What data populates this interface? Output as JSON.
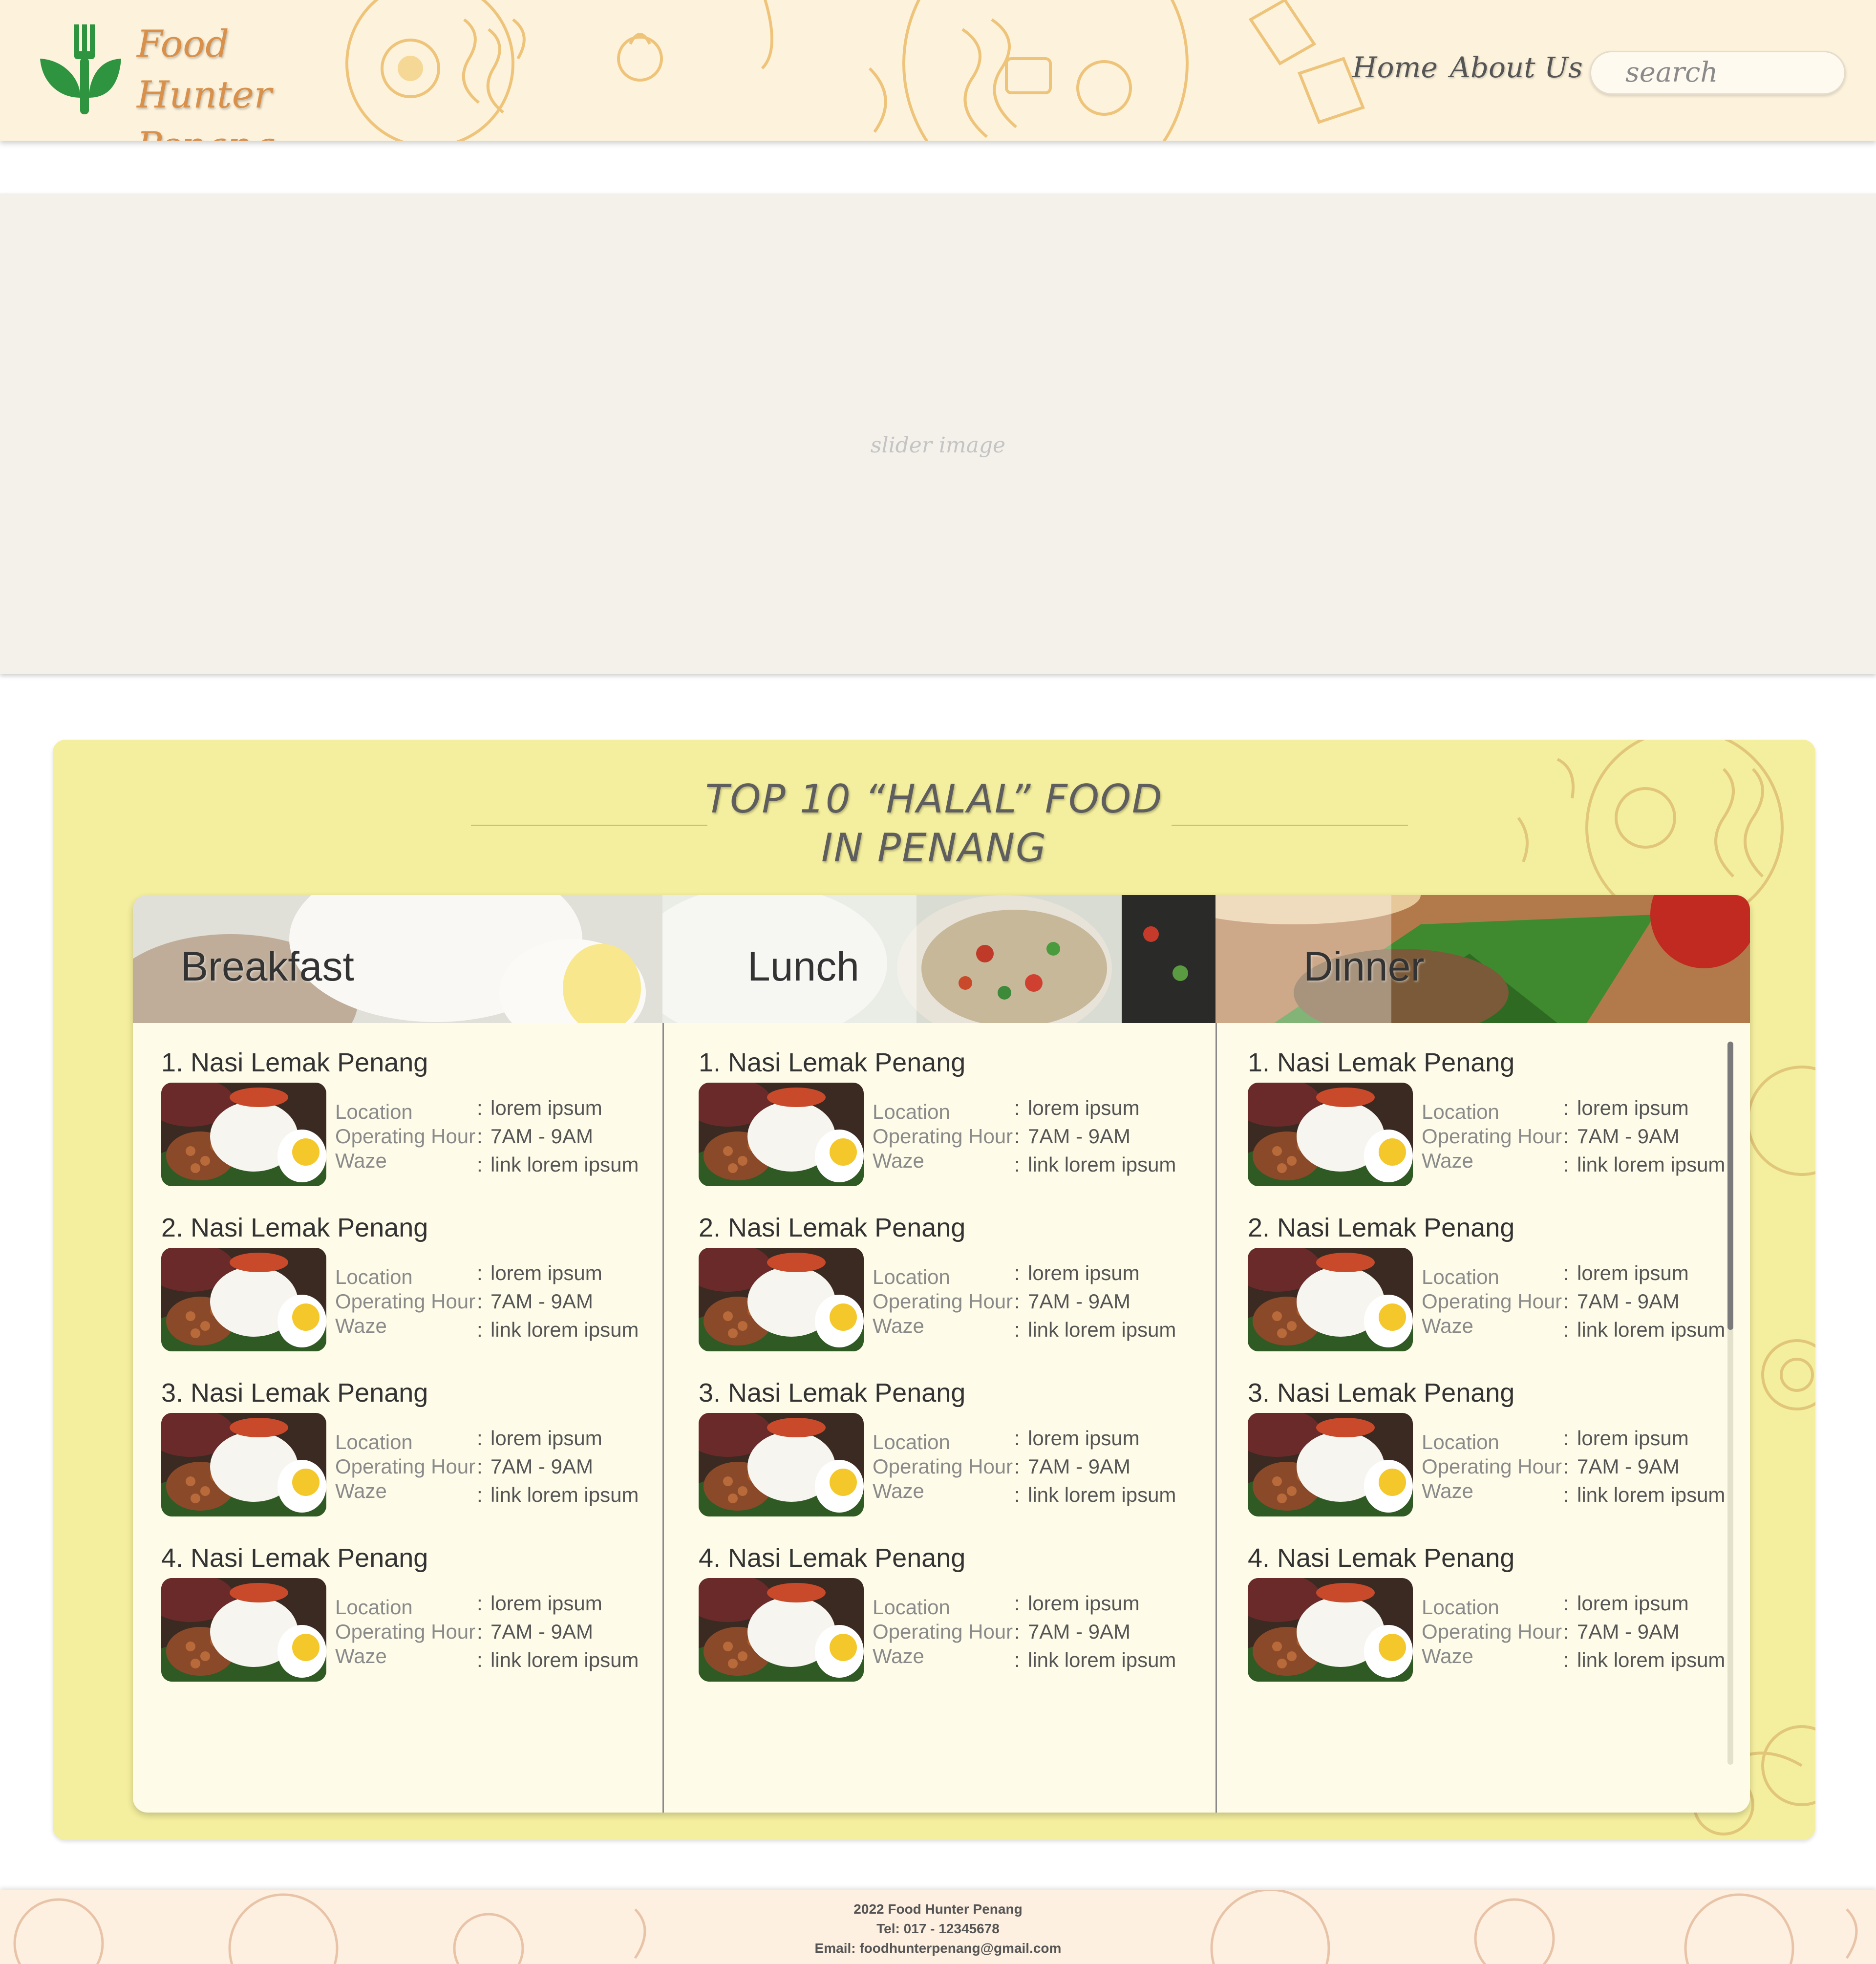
{
  "brand": {
    "line1": "Food Hunter",
    "line2": "Penang",
    "logo_icon": "fork-leaf-icon",
    "logo_color": "#2e9440",
    "text_color": "#d8904a"
  },
  "nav": {
    "home": "Home",
    "about": "About Us"
  },
  "search": {
    "placeholder": "search"
  },
  "slider": {
    "label": "slider image"
  },
  "top_section": {
    "title_line1": "TOP 10 “HALAL” FOOD",
    "title_line2": "IN PENANG",
    "background": "#f4ef9e"
  },
  "columns": [
    {
      "title": "Breakfast",
      "items": [
        {
          "name": "1. Nasi Lemak Penang",
          "location": "lorem ipsum",
          "hours": "7AM - 9AM",
          "waze": "link lorem ipsum"
        },
        {
          "name": "2. Nasi Lemak Penang",
          "location": "lorem ipsum",
          "hours": "7AM - 9AM",
          "waze": "link lorem ipsum"
        },
        {
          "name": "3. Nasi Lemak Penang",
          "location": "lorem ipsum",
          "hours": "7AM - 9AM",
          "waze": "link lorem ipsum"
        },
        {
          "name": "4. Nasi Lemak Penang",
          "location": "lorem ipsum",
          "hours": "7AM - 9AM",
          "waze": "link lorem ipsum"
        }
      ]
    },
    {
      "title": "Lunch",
      "items": [
        {
          "name": "1. Nasi Lemak Penang",
          "location": "lorem ipsum",
          "hours": "7AM - 9AM",
          "waze": "link lorem ipsum"
        },
        {
          "name": "2. Nasi Lemak Penang",
          "location": "lorem ipsum",
          "hours": "7AM - 9AM",
          "waze": "link lorem ipsum"
        },
        {
          "name": "3. Nasi Lemak Penang",
          "location": "lorem ipsum",
          "hours": "7AM - 9AM",
          "waze": "link lorem ipsum"
        },
        {
          "name": "4. Nasi Lemak Penang",
          "location": "lorem ipsum",
          "hours": "7AM - 9AM",
          "waze": "link lorem ipsum"
        }
      ]
    },
    {
      "title": "Dinner",
      "items": [
        {
          "name": "1. Nasi Lemak Penang",
          "location": "lorem ipsum",
          "hours": "7AM - 9AM",
          "waze": "link lorem ipsum"
        },
        {
          "name": "2. Nasi Lemak Penang",
          "location": "lorem ipsum",
          "hours": "7AM - 9AM",
          "waze": "link lorem ipsum"
        },
        {
          "name": "3. Nasi Lemak Penang",
          "location": "lorem ipsum",
          "hours": "7AM - 9AM",
          "waze": "link lorem ipsum"
        },
        {
          "name": "4. Nasi Lemak Penang",
          "location": "lorem ipsum",
          "hours": "7AM - 9AM",
          "waze": "link lorem ipsum"
        }
      ]
    }
  ],
  "labels": {
    "location": "Location",
    "hours": "Operating Hour",
    "waze": "Waze",
    "separator": ":"
  },
  "footer": {
    "line1": "2022 Food Hunter Penang",
    "line2": "Tel: 017 - 12345678",
    "line3": "Email: foodhunterpenang@gmail.com"
  }
}
